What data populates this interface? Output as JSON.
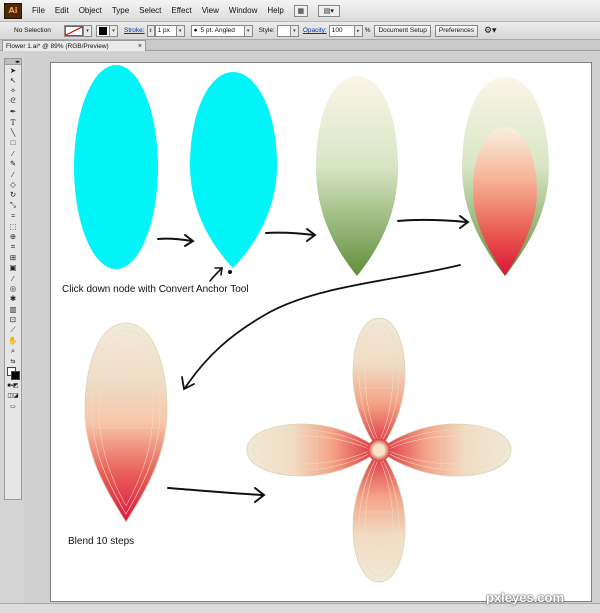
{
  "app": {
    "logo": "Ai",
    "menus": [
      "File",
      "Edit",
      "Object",
      "Type",
      "Select",
      "Effect",
      "View",
      "Window",
      "Help"
    ]
  },
  "control": {
    "selection": "No Selection",
    "stroke_label": "Stroke:",
    "stroke_weight": "1 px",
    "brush": "5 pt. Angled",
    "style_label": "Style:",
    "opacity_label": "Opacity:",
    "opacity_value": "100",
    "opacity_unit": "%",
    "doc_setup": "Document Setup",
    "preferences": "Preferences"
  },
  "document": {
    "tab_title": "Flower 1.ai* @ 89% (RGB/Preview)",
    "close": "×"
  },
  "canvas": {
    "caption_convert": "Click down node with Convert Anchor Tool",
    "caption_blend": "Blend 10 steps"
  },
  "colors": {
    "cyan": "#00f4f8",
    "green": "#6e9a4a",
    "cream": "#f5efe0",
    "red": "#e0223c",
    "salmon": "#f6a58a"
  },
  "watermark": "pxleyes.com"
}
